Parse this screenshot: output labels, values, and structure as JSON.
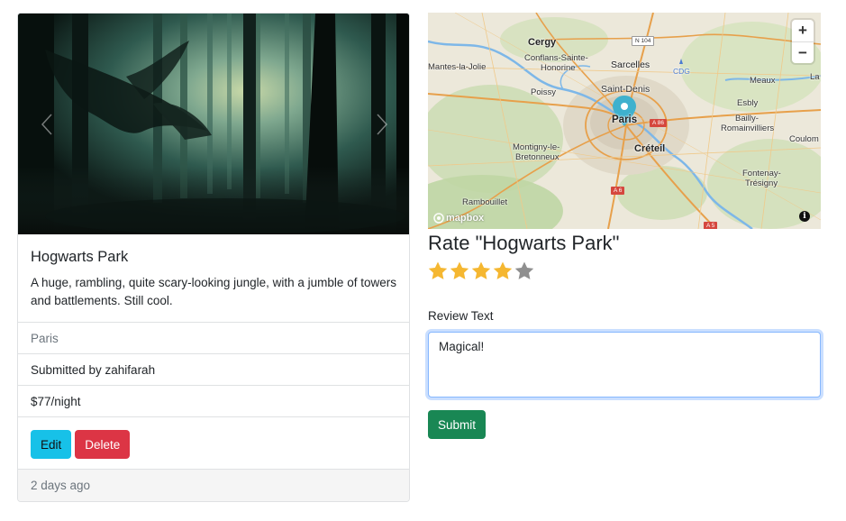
{
  "campground": {
    "title": "Hogwarts Park",
    "description": "A huge, rambling, quite scary-looking jungle, with a jumble of towers and battlements. Still cool.",
    "location": "Paris",
    "submitted_by": "Submitted by zahifarah",
    "price": "$77/night",
    "posted": "2 days ago"
  },
  "actions": {
    "edit_label": "Edit",
    "delete_label": "Delete"
  },
  "carousel": {
    "prev_icon": "chevron-left-icon",
    "next_icon": "chevron-right-icon"
  },
  "map": {
    "zoom_in": "+",
    "zoom_out": "−",
    "attribution_logo": "mapbox",
    "info_icon": "i",
    "labels": {
      "cergy": "Cergy",
      "conflans": "Conflans-Sainte-",
      "honorine": "Honorine",
      "sarcelles": "Sarcelles",
      "cdg": "CDG",
      "mantes": "Mantes-la-Jolie",
      "poissy": "Poissy",
      "saint_denis": "Saint-Denis",
      "meaux": "Meaux",
      "la_fe": "La Fe",
      "paris": "Paris",
      "esbly": "Esbly",
      "bailly": "Bailly-",
      "romainvilliers": "Romainvilliers",
      "montigny": "Montigny-le-",
      "bretonneux": "Bretonneux",
      "creteil": "Créteil",
      "coulom": "Coulom",
      "fontenay": "Fontenay-",
      "tresigny": "Trésigny",
      "rambouillet": "Rambouillet",
      "n104": "N 104",
      "a86": "A 86",
      "a6": "A 6",
      "a5": "A 5"
    }
  },
  "rating": {
    "title": "Rate \"Hogwarts Park\"",
    "value": 4,
    "max": 5,
    "filled_color": "#f5b731",
    "empty_color": "#8f8f8f"
  },
  "review": {
    "label": "Review Text",
    "value": "Magical!",
    "submit_label": "Submit"
  }
}
